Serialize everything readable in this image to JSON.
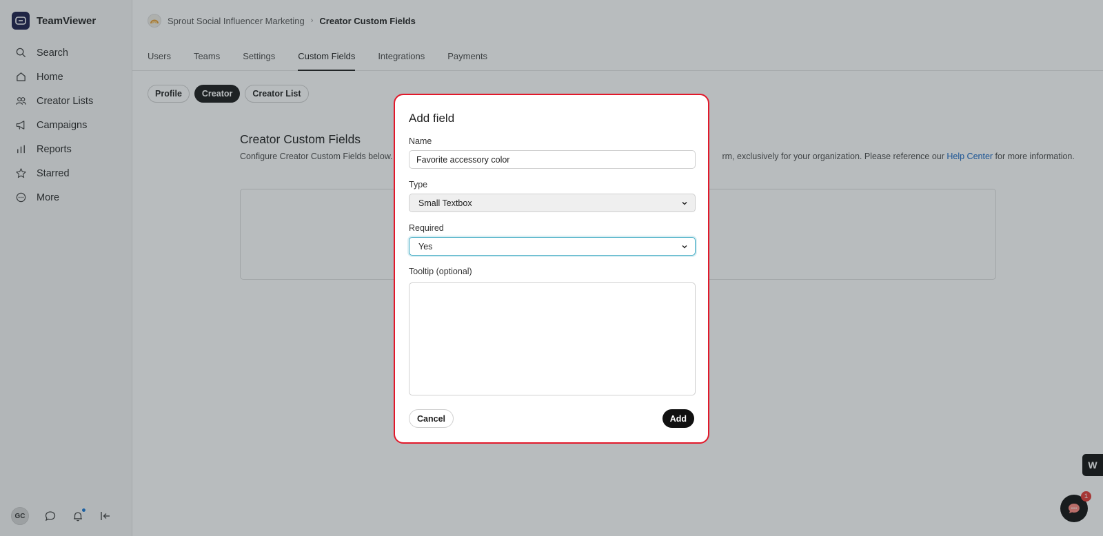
{
  "sidebar": {
    "brand_name": "TeamViewer",
    "items": [
      {
        "label": "Search",
        "icon": "search-icon"
      },
      {
        "label": "Home",
        "icon": "home-icon"
      },
      {
        "label": "Creator Lists",
        "icon": "users-icon"
      },
      {
        "label": "Campaigns",
        "icon": "megaphone-icon"
      },
      {
        "label": "Reports",
        "icon": "bar-chart-icon"
      },
      {
        "label": "Starred",
        "icon": "star-icon"
      },
      {
        "label": "More",
        "icon": "more-circle-icon"
      }
    ],
    "avatar_initials": "GC"
  },
  "breadcrumb": {
    "parent": "Sprout Social Influencer Marketing",
    "separator": "›",
    "current": "Creator Custom Fields"
  },
  "tabs": [
    {
      "label": "Users"
    },
    {
      "label": "Teams"
    },
    {
      "label": "Settings"
    },
    {
      "label": "Custom Fields",
      "active": true
    },
    {
      "label": "Integrations"
    },
    {
      "label": "Payments"
    }
  ],
  "pills": [
    {
      "label": "Profile"
    },
    {
      "label": "Creator",
      "active": true
    },
    {
      "label": "Creator List"
    }
  ],
  "section": {
    "title": "Creator Custom Fields",
    "desc_before": "Configure Creator Custom Fields below. T",
    "desc_after": "rm, exclusively for your organization. Please reference our ",
    "link": "Help Center",
    "desc_end": " for more information."
  },
  "widgets": {
    "w_badge": "W",
    "chat_count": "1"
  },
  "modal": {
    "title": "Add field",
    "name_label": "Name",
    "name_value": "Favorite accessory color",
    "type_label": "Type",
    "type_value": "Small Textbox",
    "required_label": "Required",
    "required_value": "Yes",
    "tooltip_label": "Tooltip (optional)",
    "tooltip_value": "",
    "cancel_label": "Cancel",
    "add_label": "Add"
  },
  "colors": {
    "modal_border": "#e2182a",
    "focus_ring": "#3aa8c1",
    "link": "#1565c0",
    "notif_dot": "#1976d2",
    "chat_badge": "#e53935"
  }
}
